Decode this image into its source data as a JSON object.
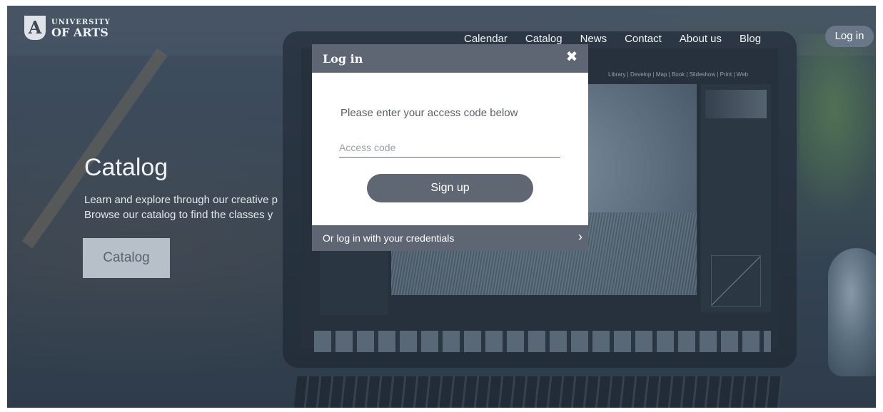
{
  "header": {
    "logo": {
      "line1": "UNIVERSITY",
      "line2": "OF ARTS",
      "icon": "university-logo-icon"
    },
    "nav": [
      "Calendar",
      "Catalog",
      "News",
      "Contact",
      "About us",
      "Blog"
    ],
    "login_label": "Log in"
  },
  "hero": {
    "title": "Catalog",
    "text_line1": "Learn and explore through our creative p",
    "text_line2": "Browse our catalog to find the classes y",
    "button_label": "Catalog"
  },
  "background_screen": {
    "lightroom_menu": "Library | Develop | Map | Book | Slideshow | Print | Web"
  },
  "modal": {
    "title": "Log in",
    "close_icon": "close-icon",
    "prompt": "Please enter your access code below",
    "input_placeholder": "Access code",
    "input_value": "",
    "signup_label": "Sign up",
    "footer_link": "Or log in with your credentials",
    "footer_icon": "chevron-right-icon"
  },
  "colors": {
    "modal_header": "#5d6672",
    "button": "#5f6772",
    "login_pill": "#6a7789"
  }
}
